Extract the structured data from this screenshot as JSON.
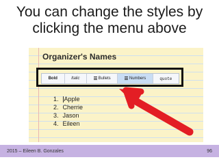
{
  "slide": {
    "title": "You can change the styles by clicking the menu above"
  },
  "panel": {
    "title": "Organizer's Names"
  },
  "toolbar": {
    "bold": "Bold",
    "italic": "Italic",
    "bullets": "Bullets",
    "numbers": "Numbers",
    "quote": "quote"
  },
  "list": {
    "items": [
      {
        "num": "1.",
        "name": "Apple"
      },
      {
        "num": "2.",
        "name": "Cherrie"
      },
      {
        "num": "3.",
        "name": "Jason"
      },
      {
        "num": "4.",
        "name": "Eileen"
      }
    ]
  },
  "footer": {
    "left": "2015 – Eileen B. Gonzales",
    "page": "96"
  },
  "colors": {
    "arrow": "#e31e24",
    "footer": "#c6b2e2",
    "panel": "#fbf3c8",
    "active_button": "#c9ddf4"
  },
  "icons": [
    "bullets-icon",
    "numbers-icon",
    "red-arrow"
  ]
}
